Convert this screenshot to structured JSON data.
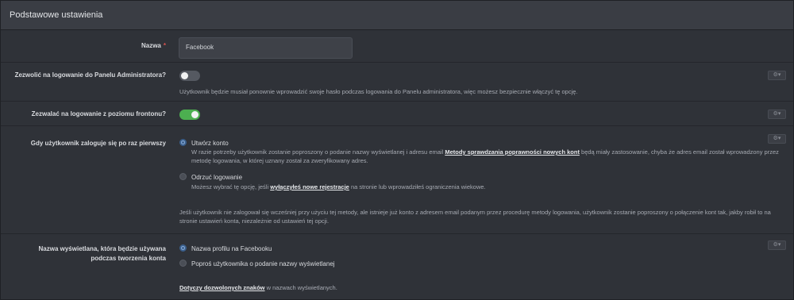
{
  "header": {
    "title": "Podstawowe ustawienia"
  },
  "name_field": {
    "label": "Nazwa",
    "required_mark": "*",
    "value": "Facebook"
  },
  "admin_login": {
    "label": "Zezwolić na logowanie do Panelu Administratora?",
    "enabled": false,
    "hint": "Użytkownik będzie musiał ponownie wprowadzić swoje hasło podczas logowania do Panelu administratora, więc możesz bezpiecznie włączyć tę opcję.",
    "gear": "⚙▾"
  },
  "frontend_login": {
    "label": "Zezwalać na logowanie z poziomu frontonu?",
    "enabled": true,
    "gear": "⚙▾"
  },
  "first_login": {
    "label": "Gdy użytkownik zaloguje się po raz pierwszy",
    "gear": "⚙▾",
    "options": [
      {
        "label": "Utwórz konto",
        "selected": true,
        "desc_before": "W razie potrzeby użytkownik zostanie poproszony o podanie nazwy wyświetlanej i adresu email ",
        "desc_link": "Metody sprawdzania poprawności nowych kont",
        "desc_after": " będą miały zastosowanie, chyba że adres email został wprowadzony przez metodę logowania, w której uznany został za zweryfikowany adres."
      },
      {
        "label": "Odrzuć logowanie",
        "selected": false,
        "desc_before": "Możesz wybrać tę opcję, jeśli ",
        "desc_link": "wyłączyłeś nowe rejestracje",
        "desc_after": " na stronie lub wprowadziłeś ograniczenia wiekowe."
      }
    ],
    "note": "Jeśli użytkownik nie zalogował się wcześniej przy użyciu tej metody, ale istnieje już konto z adresem email podanym przez procedurę metody logowania, użytkownik zostanie poproszony o połączenie kont tak, jakby robił to na stronie ustawień konta, niezależnie od ustawień tej opcji."
  },
  "display_name": {
    "label_line1": "Nazwa wyświetlana, która będzie używana",
    "label_line2": "podczas tworzenia konta",
    "gear": "⚙▾",
    "options": [
      {
        "label": "Nazwa profilu na Facebooku",
        "selected": true
      },
      {
        "label": "Poproś użytkownika o podanie nazwy wyświetlanej",
        "selected": false
      }
    ],
    "note_link": "Dotyczy dozwolonych znaków",
    "note_after": " w nazwach wyświetlanych."
  },
  "colors": {
    "toggle_on": "#4caf50",
    "toggle_off": "#555961",
    "required": "#d9534f"
  }
}
